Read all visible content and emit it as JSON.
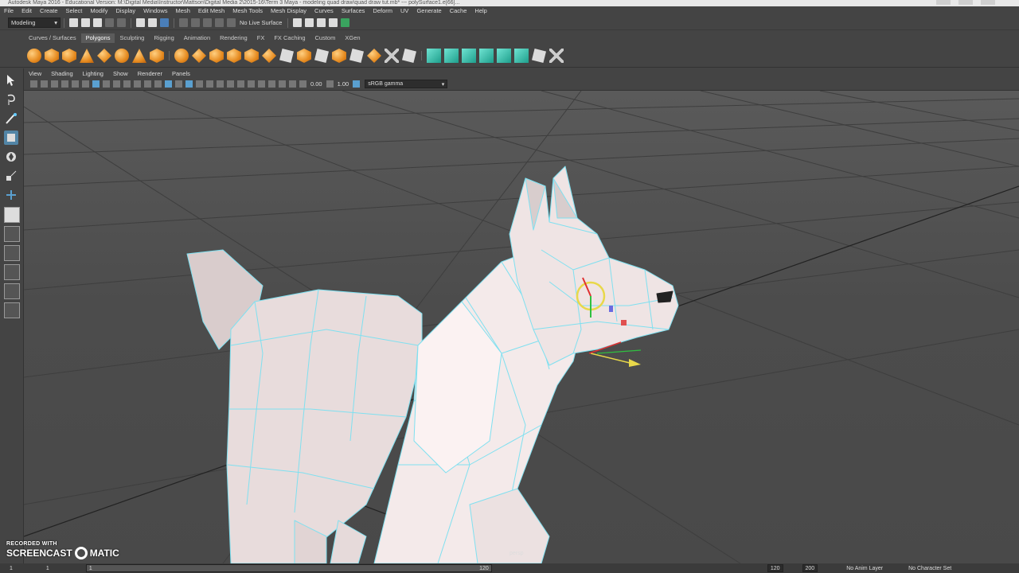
{
  "titlebar": {
    "text": "Autodesk Maya 2016 - Educational Version: M:\\Digital Media\\Instructor\\Mattson\\Digital Media 2\\2015-16\\Term 3 Maya - modeling quad draw\\quad draw tut.mb* --- polySurface1.e[66]..."
  },
  "menubar": {
    "items": [
      "File",
      "Edit",
      "Create",
      "Select",
      "Modify",
      "Display",
      "Windows",
      "Mesh",
      "Edit Mesh",
      "Mesh Tools",
      "Mesh Display",
      "Curves",
      "Surfaces",
      "Deform",
      "UV",
      "Generate",
      "Cache",
      "Help"
    ]
  },
  "statusline": {
    "mode": "Modeling",
    "live_surface": "No Live Surface"
  },
  "shelf": {
    "tabs": [
      "Curves / Surfaces",
      "Polygons",
      "Sculpting",
      "Rigging",
      "Animation",
      "Rendering",
      "FX",
      "FX Caching",
      "Custom",
      "XGen"
    ],
    "active_tab": "Polygons"
  },
  "panel": {
    "menu": [
      "View",
      "Shading",
      "Lighting",
      "Show",
      "Renderer",
      "Panels"
    ],
    "exposure": "0.00",
    "gamma": "1.00",
    "colorspace": "sRGB gamma",
    "camera_label": "persp"
  },
  "timeline": {
    "start": "1",
    "current": "1",
    "range_start_marker": "1",
    "range_end": "120",
    "end_a": "120",
    "end_b": "200",
    "anim_layer": "No Anim Layer",
    "char_set": "No Character Set"
  },
  "watermark": {
    "recorded": "RECORDED WITH",
    "brand_left": "SCREENCAST",
    "brand_right": "MATIC"
  },
  "colors": {
    "background": "#444444",
    "viewport_top": "#5a5a5a",
    "mesh_wire": "#7fe0f0",
    "mesh_fill": "#e9dcdc",
    "selection": "#5285a6",
    "shelf_orange": "#e58a1f"
  }
}
